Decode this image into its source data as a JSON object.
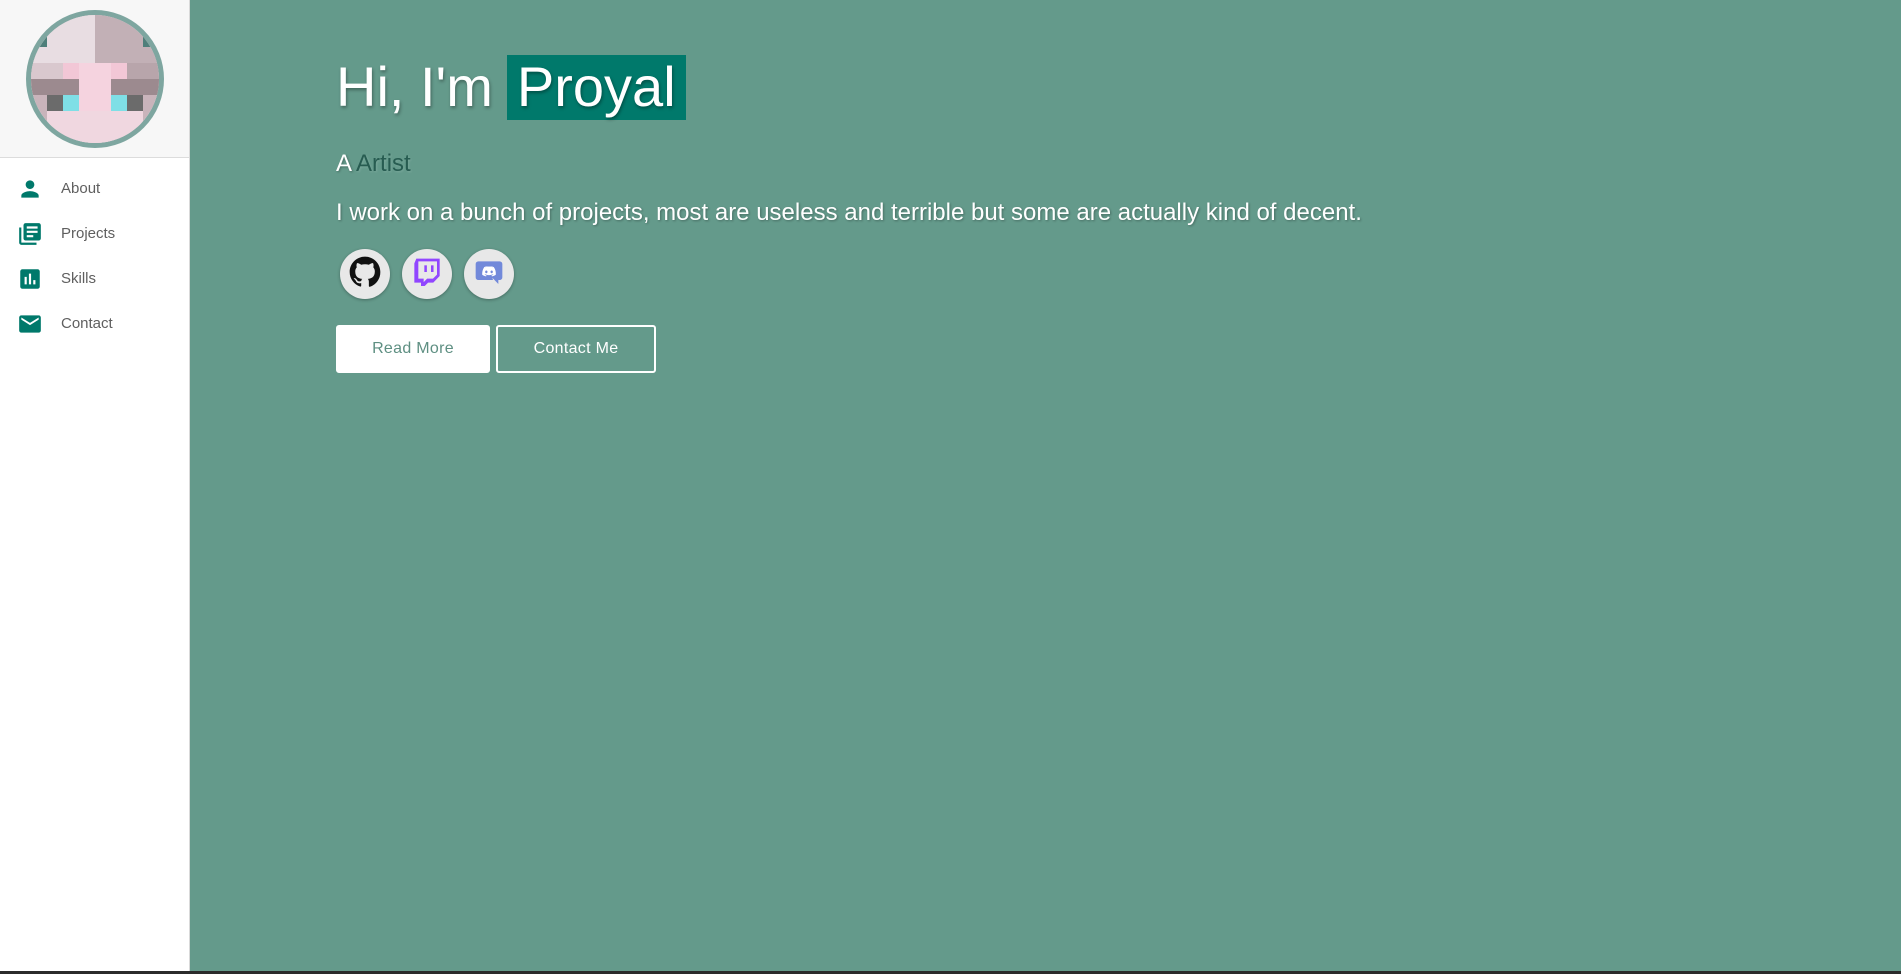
{
  "profile": {
    "avatar_alt": "Proyal avatar"
  },
  "nav": {
    "items": [
      {
        "label": "About",
        "icon": "person-icon"
      },
      {
        "label": "Projects",
        "icon": "projects-icon"
      },
      {
        "label": "Skills",
        "icon": "bar-chart-icon"
      },
      {
        "label": "Contact",
        "icon": "mail-icon"
      }
    ]
  },
  "hero": {
    "greeting": "Hi, I'm",
    "name": "Proyal",
    "subtitle_prefix": "A",
    "role": "Artist",
    "description": "I work on a bunch of projects, most are useless and terrible but some are actually kind of decent."
  },
  "socials": [
    {
      "icon": "github-icon"
    },
    {
      "icon": "twitch-icon"
    },
    {
      "icon": "discord-icon"
    }
  ],
  "buttons": {
    "read_more": "Read More",
    "contact_me": "Contact Me"
  },
  "colors": {
    "accent": "#00796b",
    "background": "#649a8b",
    "role_text": "#275c51"
  }
}
